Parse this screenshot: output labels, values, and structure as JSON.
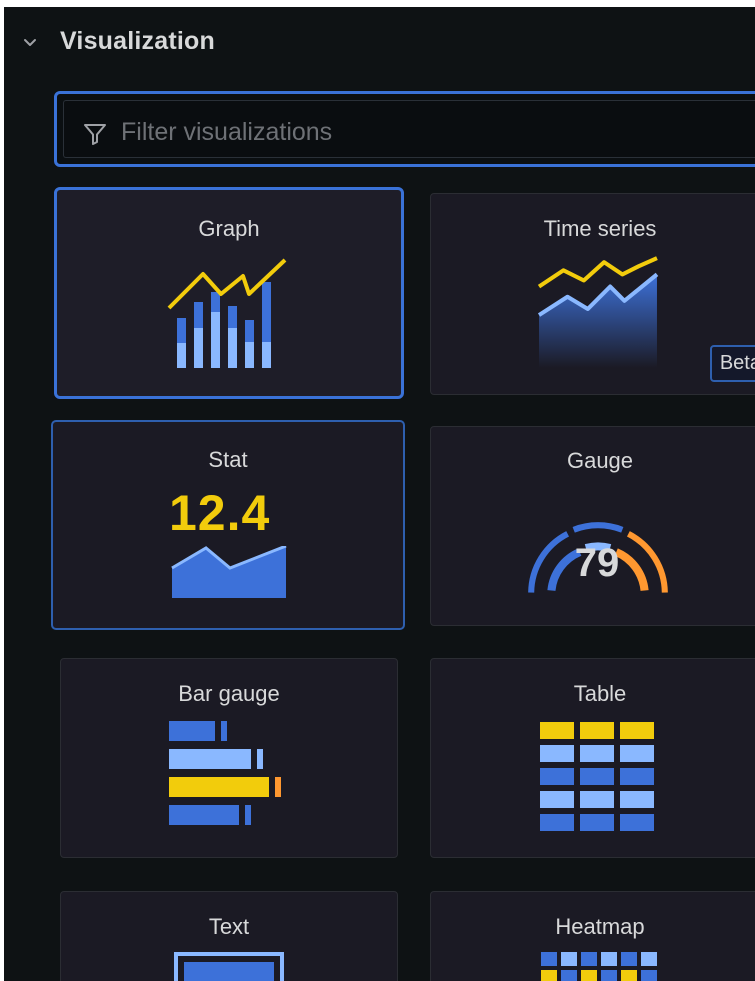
{
  "section": {
    "title": "Visualization",
    "chevron_icon": "chevron-down-icon"
  },
  "filter": {
    "placeholder": "Filter visualizations",
    "value": "",
    "icon": "filter-icon"
  },
  "cards": {
    "graph": {
      "label": "Graph",
      "state": "selected"
    },
    "timeseries": {
      "label": "Time series",
      "badge": "Beta"
    },
    "stat": {
      "label": "Stat",
      "value": "12.4",
      "state": "hovered"
    },
    "gauge": {
      "label": "Gauge",
      "value": "79"
    },
    "bargauge": {
      "label": "Bar gauge"
    },
    "table": {
      "label": "Table"
    },
    "text": {
      "label": "Text"
    },
    "heatmap": {
      "label": "Heatmap"
    }
  },
  "colors": {
    "panel_bg": "#0e1214",
    "card_bg": "#1b1a24",
    "accent_blue": "#3a72d8",
    "icon_blue": "#3d71d9",
    "icon_light_blue": "#8ab8ff",
    "icon_yellow": "#f2cc0c",
    "icon_orange": "#ff9830"
  }
}
